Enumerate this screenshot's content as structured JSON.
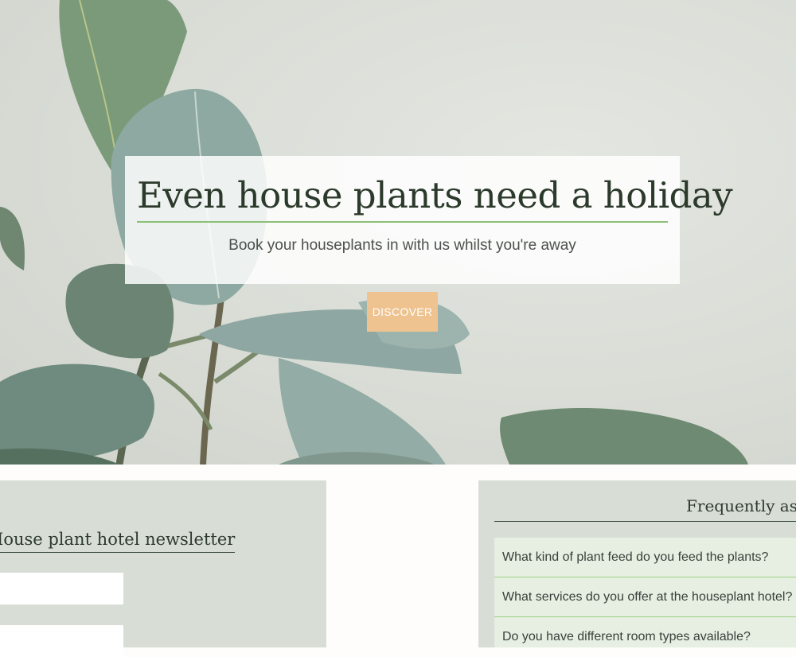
{
  "hero": {
    "title": "Even house plants need a holiday",
    "subtitle": "Book your houseplants in with us whilst you're away",
    "button_label": "DISCOVER"
  },
  "newsletter": {
    "heading": "House plant hotel newsletter"
  },
  "faq": {
    "heading": "Frequently asked questions",
    "items": [
      {
        "question": "What kind of plant feed do you feed the plants?"
      },
      {
        "question": "What services do you offer at the houseplant hotel?"
      },
      {
        "question": "Do you have different room types available?"
      }
    ]
  },
  "colors": {
    "accent_button": "#efc38f",
    "title_underline": "#8cbf78",
    "panel_background": "#d8ddd6",
    "faq_item_background": "#e6efe2"
  }
}
